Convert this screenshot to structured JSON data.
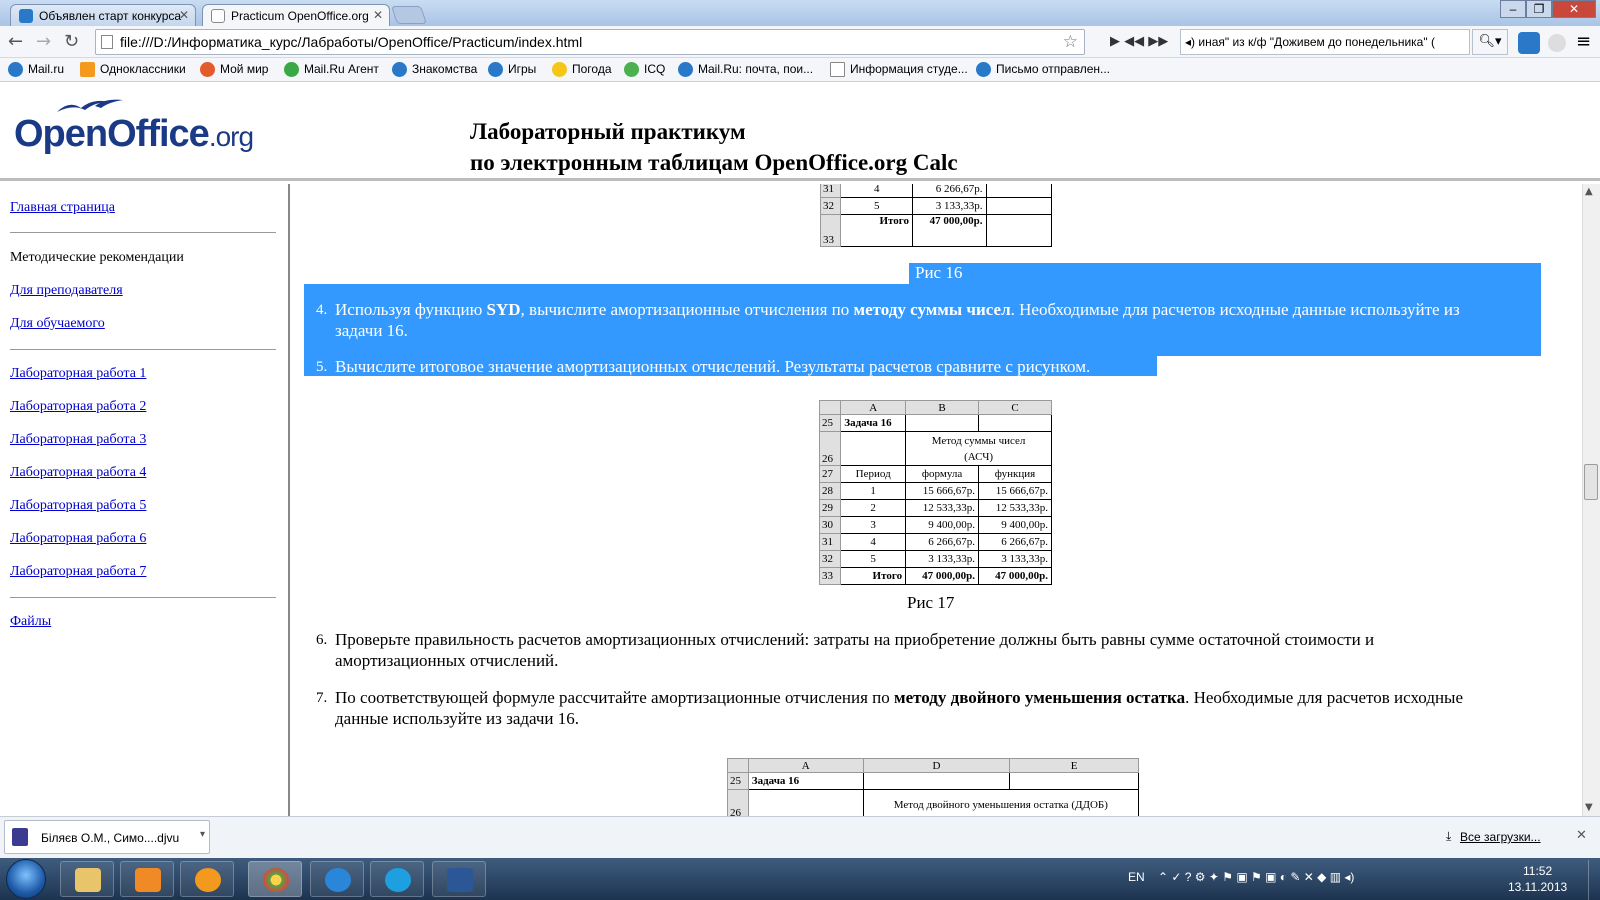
{
  "browser": {
    "tabs": [
      {
        "label": "Объявлен старт конкурса"
      },
      {
        "label": "Practicum OpenOffice.org"
      }
    ],
    "address": "file:///D:/Информатика_курс/Лабработы/OpenOffice/Practicum/index.html",
    "media_text": "иная\" из к/ф \"Доживем до понедельника\" (",
    "bookmarks": [
      "Mail.ru",
      "Одноклассники",
      "Мой мир",
      "Mail.Ru Агент",
      "Знакомства",
      "Игры",
      "Погода",
      "ICQ",
      "Mail.Ru: почта, пои...",
      "Информация студе...",
      "Письмо отправлен..."
    ]
  },
  "header": {
    "logo_main": "OpenOffice",
    "logo_suffix": ".org",
    "title_line1": "Лабораторный практикум",
    "title_line2": "по электронным таблицам OpenOffice.org Calc"
  },
  "sidebar": {
    "home": "Главная страница",
    "methodical": "Методические рекомендации",
    "teacher": "Для преподавателя",
    "student": "Для обучаемого",
    "labs": [
      "Лабораторная работа 1",
      "Лабораторная работа 2",
      "Лабораторная работа 3",
      "Лабораторная работа 4",
      "Лабораторная работа 5",
      "Лабораторная работа 6",
      "Лабораторная работа 7"
    ],
    "files": "Файлы"
  },
  "content": {
    "top_table": {
      "rows": [
        {
          "n": "31",
          "period": "4",
          "value": "6 266,67р."
        },
        {
          "n": "32",
          "period": "5",
          "value": "3 133,33р."
        },
        {
          "n": "33",
          "period": "Итого",
          "value": "47 000,00р."
        }
      ]
    },
    "fig16": "Рис 16",
    "item4_num": "4.",
    "item4_a": "Используя функцию ",
    "item4_b": "SYD",
    "item4_c": ", вычислите амортизационные отчисления по ",
    "item4_d": "методу суммы чисел",
    "item4_e": ". Необходимые для расчетов исходные данные используйте из",
    "item4_line2": "задачи 16.",
    "item5_num": "5.",
    "item5": "Вычислите итоговое значение амортизационных отчислений. Результаты расчетов сравните с рисунком.",
    "fig17_table": {
      "cols": [
        "A",
        "B",
        "C"
      ],
      "task": "Задача 16",
      "method_l1": "Метод суммы чисел",
      "method_l2": "(АСЧ)",
      "h_period": "Период",
      "h_formula": "формула",
      "h_function": "функция",
      "rows": [
        {
          "n": "28",
          "p": "1",
          "f": "15 666,67р.",
          "g": "15 666,67р."
        },
        {
          "n": "29",
          "p": "2",
          "f": "12 533,33р.",
          "g": "12 533,33р."
        },
        {
          "n": "30",
          "p": "3",
          "f": "9 400,00р.",
          "g": "9 400,00р."
        },
        {
          "n": "31",
          "p": "4",
          "f": "6 266,67р.",
          "g": "6 266,67р."
        },
        {
          "n": "32",
          "p": "5",
          "f": "3 133,33р.",
          "g": "3 133,33р."
        },
        {
          "n": "33",
          "p": "Итого",
          "f": "47 000,00р.",
          "g": "47 000,00р."
        }
      ],
      "row_nums": [
        "25",
        "26",
        "27"
      ]
    },
    "fig17": "Рис 17",
    "item6_num": "6.",
    "item6_line1": "Проверьте правильность расчетов амортизационных отчислений: затраты на приобретение должны быть равны сумме остаточной стоимости и",
    "item6_line2": "амортизационных отчислений.",
    "item7_num": "7.",
    "item7_a": "По соответствующей формуле рассчитайте амортизационные отчисления по ",
    "item7_b": "методу двойного уменьшения остатка",
    "item7_c": ". Необходимые для расчетов исходные",
    "item7_line2": "данные используйте из задачи 16.",
    "bottom_table": {
      "cols": [
        "A",
        "D",
        "E"
      ],
      "task": "Задача 16",
      "method": "Метод двойного уменьшения остатка (ДДОБ)",
      "row_nums": [
        "25",
        "26"
      ]
    }
  },
  "downloads": {
    "file": "Біляєв О.М., Симо....djvu",
    "all": "Все загрузки..."
  },
  "taskbar": {
    "lang": "EN",
    "time": "11:52",
    "date": "13.11.2013"
  }
}
